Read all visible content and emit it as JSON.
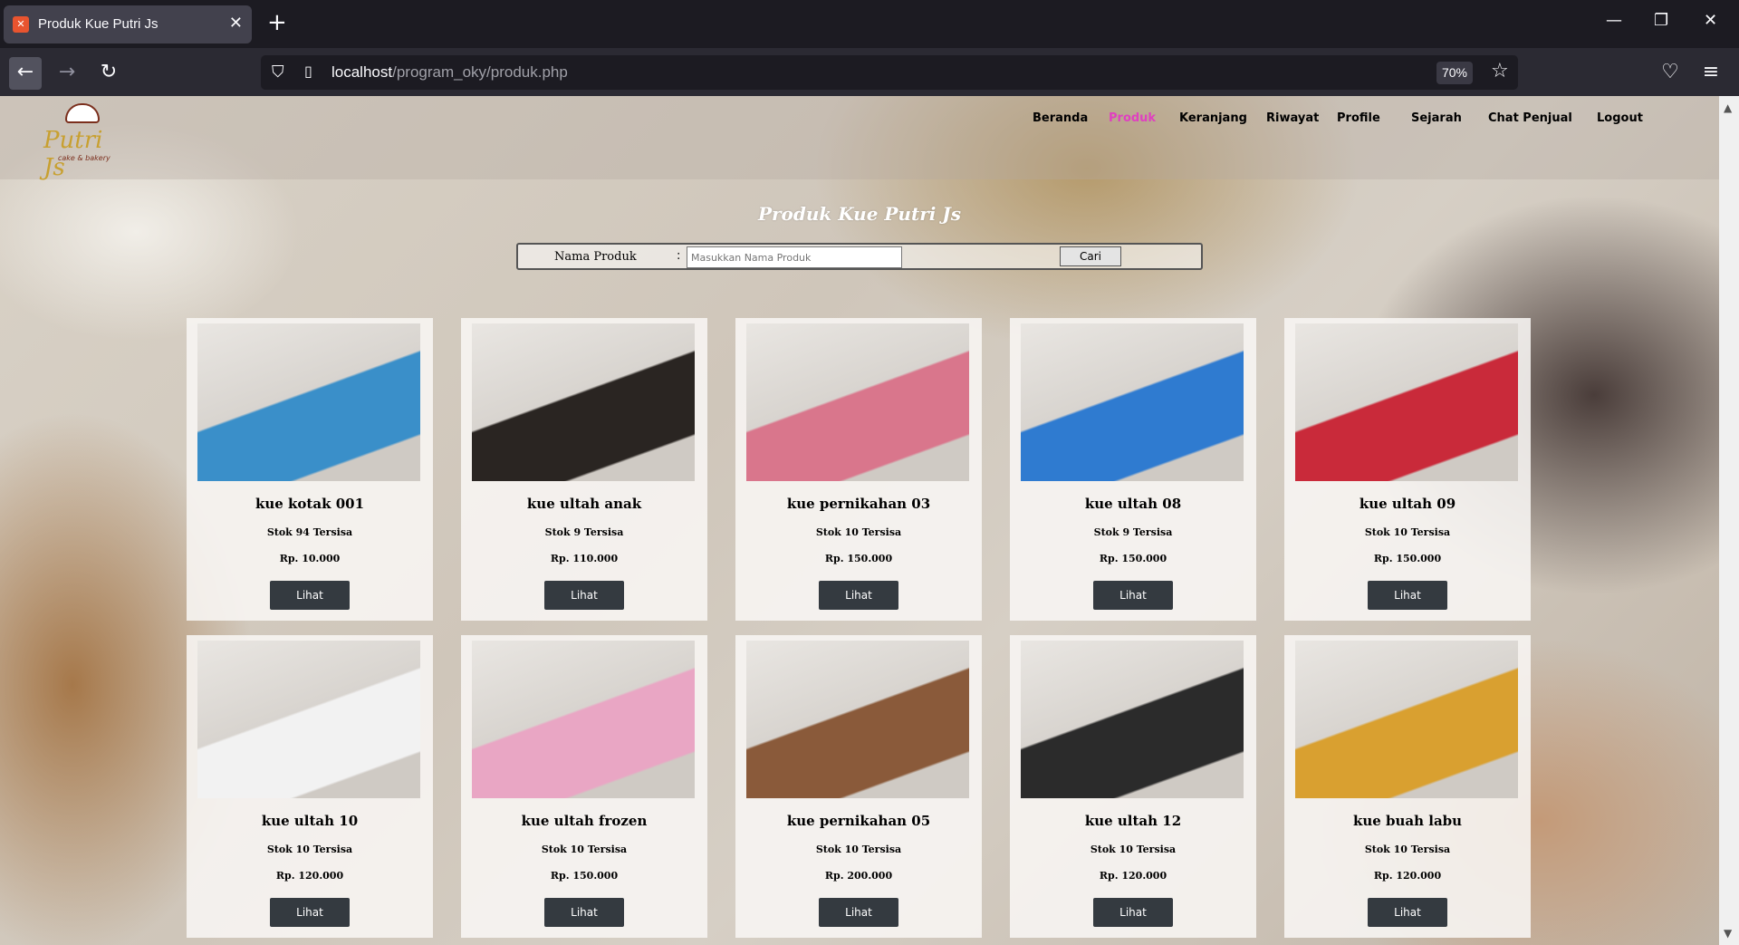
{
  "browser": {
    "tab_title": "Produk Kue Putri Js",
    "tab_close": "✕",
    "new_tab": "+",
    "url_host": "localhost",
    "url_path": "/program_oky/produk.php",
    "zoom": "70%"
  },
  "site": {
    "logo_text": "Putri Js",
    "logo_sub": "cake & bakery",
    "nav": [
      {
        "label": "Beranda",
        "active": false
      },
      {
        "label": "Produk",
        "active": true
      },
      {
        "label": "Keranjang",
        "active": false
      },
      {
        "label": "Riwayat",
        "active": false
      },
      {
        "label": "Profile",
        "active": false
      },
      {
        "label": "Sejarah",
        "active": false
      },
      {
        "label": "Chat Penjual",
        "active": false
      },
      {
        "label": "Logout",
        "active": false
      }
    ],
    "title": "Produk Kue Putri Js",
    "search": {
      "label": "Nama Produk",
      "colon": ":",
      "placeholder": "Masukkan Nama Produk",
      "button": "Cari"
    }
  },
  "products": [
    {
      "name": "kue kotak 001",
      "stock": "Stok 94 Tersisa",
      "price": "Rp. 10.000",
      "button": "Lihat",
      "color": "#3a8fc9"
    },
    {
      "name": "kue ultah anak",
      "stock": "Stok 9 Tersisa",
      "price": "Rp. 110.000",
      "button": "Lihat",
      "color": "#2a2522"
    },
    {
      "name": "kue pernikahan 03",
      "stock": "Stok 10 Tersisa",
      "price": "Rp. 150.000",
      "button": "Lihat",
      "color": "#d9768c"
    },
    {
      "name": "kue ultah 08",
      "stock": "Stok 9 Tersisa",
      "price": "Rp. 150.000",
      "button": "Lihat",
      "color": "#2f7bd0"
    },
    {
      "name": "kue ultah 09",
      "stock": "Stok 10 Tersisa",
      "price": "Rp. 150.000",
      "button": "Lihat",
      "color": "#c92a3a"
    },
    {
      "name": "kue ultah 10",
      "stock": "Stok 10 Tersisa",
      "price": "Rp. 120.000",
      "button": "Lihat",
      "color": "#f2f2f2"
    },
    {
      "name": "kue ultah frozen",
      "stock": "Stok 10 Tersisa",
      "price": "Rp. 150.000",
      "button": "Lihat",
      "color": "#e9a6c4"
    },
    {
      "name": "kue pernikahan 05",
      "stock": "Stok 10 Tersisa",
      "price": "Rp. 200.000",
      "button": "Lihat",
      "color": "#8a5a3a"
    },
    {
      "name": "kue ultah 12",
      "stock": "Stok 10 Tersisa",
      "price": "Rp. 120.000",
      "button": "Lihat",
      "color": "#2b2b2b"
    },
    {
      "name": "kue buah labu",
      "stock": "Stok 10 Tersisa",
      "price": "Rp. 120.000",
      "button": "Lihat",
      "color": "#d9a030"
    }
  ]
}
